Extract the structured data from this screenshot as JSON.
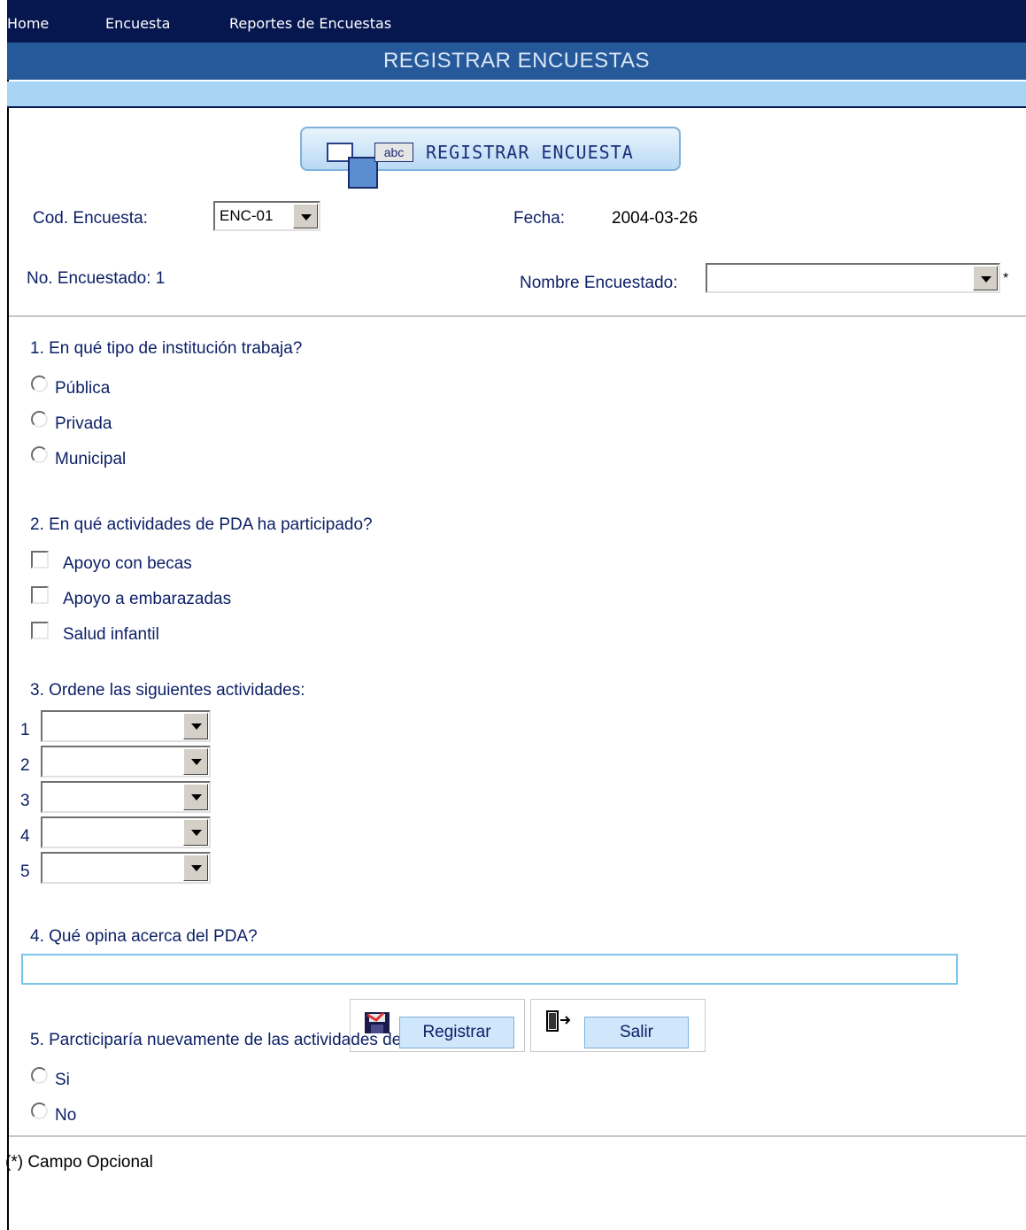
{
  "nav": {
    "items": [
      "Home",
      "Encuesta",
      "Reportes de Encuestas"
    ]
  },
  "page_title": "REGISTRAR ENCUESTAS",
  "header_button": {
    "label": "REGISTRAR ENCUESTA",
    "icon_text": "abc"
  },
  "form": {
    "cod_label": "Cod. Encuesta:",
    "cod_value": "ENC-01",
    "fecha_label": "Fecha:",
    "fecha_value": "2004-03-26",
    "no_encuestado": "No. Encuestado: 1",
    "nombre_label": "Nombre Encuestado:",
    "nombre_value": "",
    "asterisk": "*"
  },
  "q1": {
    "question": "1. En qué tipo de institución trabaja?",
    "options": [
      "Pública",
      "Privada",
      "Municipal"
    ]
  },
  "q2": {
    "question": "2. En qué actividades de PDA ha participado?",
    "options": [
      "Apoyo con becas",
      "Apoyo a embarazadas",
      "Salud infantil"
    ]
  },
  "q3": {
    "question": "3. Ordene las siguientes actividades:",
    "ranks": [
      "1",
      "2",
      "3",
      "4",
      "5"
    ]
  },
  "q4": {
    "question": "4. Qué opina acerca del PDA?",
    "value": ""
  },
  "q5": {
    "question": "5. Parcticiparía nuevamente de las actividades del PDA?",
    "options": [
      "Si",
      "No"
    ]
  },
  "footer": {
    "note": "(*) Campo Opcional",
    "registrar_label": "Registrar",
    "salir_label": "Salir"
  },
  "icons": [
    "check-list-icon",
    "abc-icon",
    "floppy-disk-icon",
    "exit-door-icon",
    "dropdown-arrow-icon"
  ]
}
